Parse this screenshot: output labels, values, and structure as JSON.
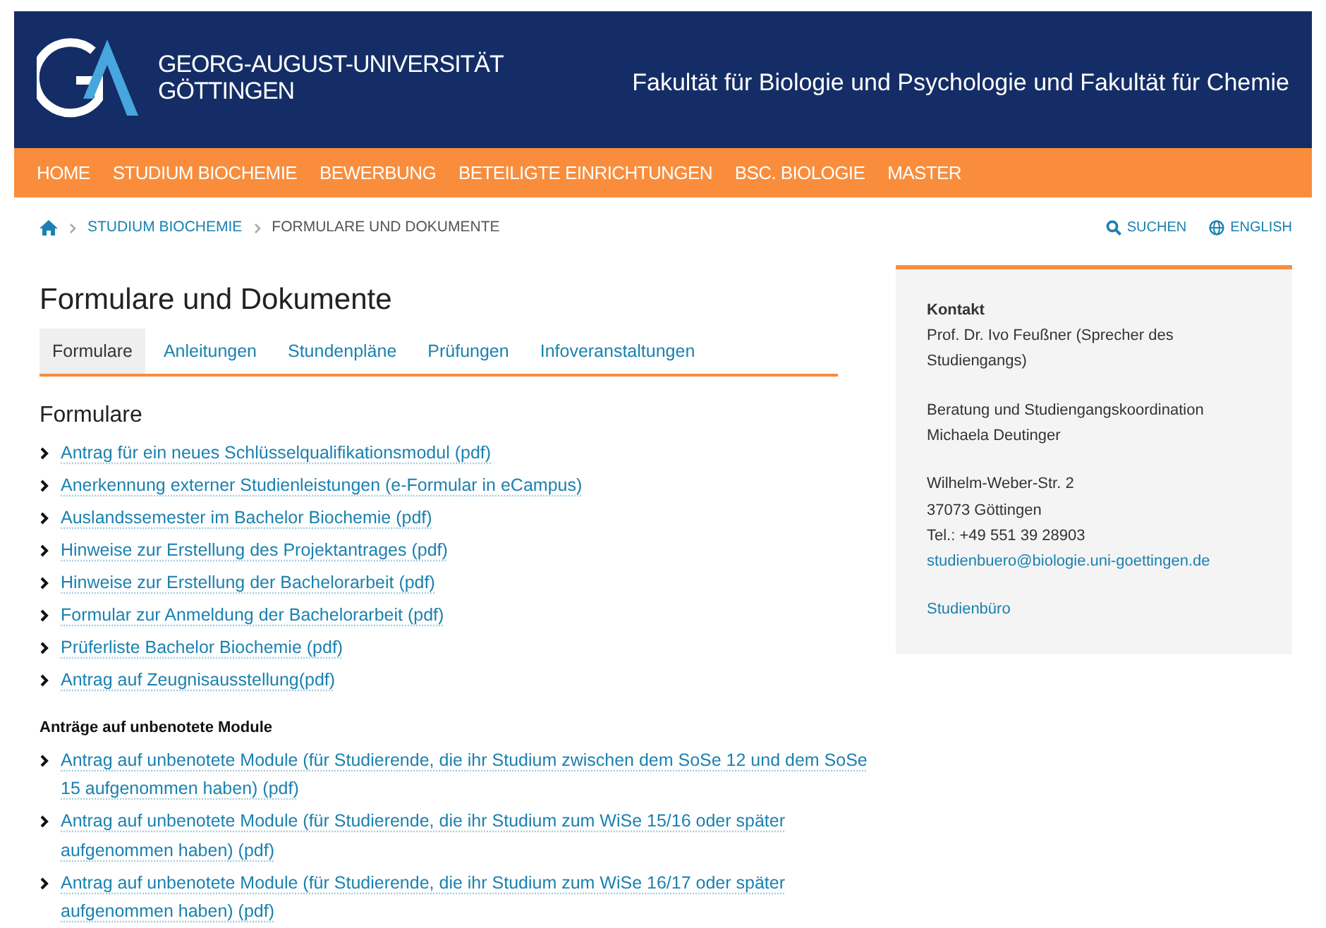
{
  "header": {
    "university": [
      "GEORG-AUGUST-UNIVERSITÄT",
      "GÖTTINGEN"
    ],
    "faculty": "Fakultät für Biologie und Psychologie und Fakultät für Chemie"
  },
  "main_nav": [
    "HOME",
    "STUDIUM BIOCHEMIE",
    "BEWERBUNG",
    "BETEILIGTE EINRICHTUNGEN",
    "BSC. BIOLOGIE",
    "MASTER"
  ],
  "breadcrumb": [
    {
      "label": "STUDIUM BIOCHEMIE",
      "link": true
    },
    {
      "label": "FORMULARE UND DOKUMENTE",
      "link": false
    }
  ],
  "tools": [
    {
      "kind": "search",
      "label": "SUCHEN"
    },
    {
      "kind": "language",
      "label": "ENGLISH"
    }
  ],
  "title": "Formulare und Dokumente",
  "tabs": [
    {
      "label": "Formulare",
      "selected": true
    },
    {
      "label": "Anleitungen",
      "selected": false
    },
    {
      "label": "Stundenpläne",
      "selected": false
    },
    {
      "label": "Prüfungen",
      "selected": false
    },
    {
      "label": "Infoveranstaltungen",
      "selected": false
    }
  ],
  "sections": [
    {
      "heading": "Formulare",
      "kind": "large",
      "links": [
        "Antrag für ein neues Schlüsselqualifikationsmodul (pdf)",
        "Anerkennung externer Studienleistungen (e-Formular in eCampus)",
        "Auslandssemester im Bachelor Biochemie (pdf)",
        "Hinweise zur Erstellung des Projektantrages (pdf)",
        "Hinweise zur Erstellung der Bachelorarbeit (pdf)",
        "Formular zur Anmeldung der Bachelorarbeit (pdf)",
        "Prüferliste Bachelor Biochemie (pdf)",
        "Antrag auf Zeugnisausstellung(pdf)"
      ]
    },
    {
      "heading": "Anträge auf unbenotete Module",
      "kind": "small",
      "links": [
        "Antrag auf unbenotete Module (für Studierende, die ihr Studium zwischen dem SoSe 12 und dem SoSe 15 aufgenommen haben) (pdf)",
        "Antrag auf unbenotete Module (für Studierende, die ihr Studium zum WiSe 15/16 oder später aufgenommen haben) (pdf)",
        "Antrag auf unbenotete Module (für Studierende, die ihr Studium zum WiSe 16/17 oder später aufgenommen haben) (pdf)"
      ]
    }
  ],
  "contact": {
    "heading": "Kontakt",
    "blocks": [
      [
        {
          "kind": "text",
          "text": "Prof. Dr. Ivo Feußner (Sprecher des Studiengangs)"
        }
      ],
      [
        {
          "kind": "text",
          "text": "Beratung und Studiengangskoordination"
        },
        {
          "kind": "text",
          "text": "Michaela Deutinger"
        }
      ],
      [
        {
          "kind": "text",
          "text": "Wilhelm-Weber-Str. 2"
        },
        {
          "kind": "text",
          "text": "37073 Göttingen"
        },
        {
          "kind": "text",
          "text": "Tel.: +49 551 39 28903"
        },
        {
          "kind": "link",
          "text": "studienbuero@biologie.uni-goettingen.de"
        }
      ],
      [
        {
          "kind": "link",
          "text": "Studienbüro"
        }
      ]
    ]
  }
}
